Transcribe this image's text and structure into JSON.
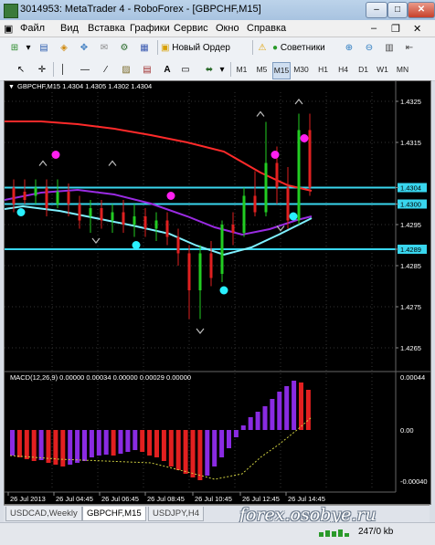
{
  "window": {
    "title": "3014953: MetaTrader 4 - RoboForex - [GBPCHF,M15]"
  },
  "menu": [
    "Файл",
    "Вид",
    "Вставка",
    "Графики",
    "Сервис",
    "Окно",
    "Справка"
  ],
  "toolbar": {
    "new_order_label": "Новый Ордер",
    "advisors_label": "Советники"
  },
  "timeframes": [
    "M1",
    "M5",
    "M15",
    "M30",
    "H1",
    "H4",
    "D1",
    "W1",
    "MN"
  ],
  "active_timeframe": "M15",
  "chart": {
    "header": "GBPCHF,M15  1.4304 1.4305 1.4302 1.4304",
    "price_ticks": [
      "1.4325",
      "1.4315",
      "1.4304",
      "1.4300",
      "1.4295",
      "1.4289",
      "1.4285",
      "1.4275",
      "1.4265"
    ],
    "price_labels_highlight": [
      "1.4304",
      "1.4300",
      "1.4289"
    ],
    "macd_header": "MACD(12,26,9) 0.00000 0.00034 0.00000 0.00029 0.00000",
    "macd_ticks": [
      "0.00044",
      "0.00",
      "-0.00040"
    ],
    "time_labels": [
      "26 Jul 2013",
      "26 Jul 04:45",
      "26 Jul 06:45",
      "26 Jul 08:45",
      "26 Jul 10:45",
      "26 Jul 12:45",
      "26 Jul 14:45"
    ]
  },
  "colors": {
    "bull": "#22cc22",
    "bear": "#e02020",
    "ma_red": "#ff2a2a",
    "ma_purple": "#9a2be2",
    "ma_cyan": "#7ff0ff",
    "level_line": "#39d6ee",
    "dot_magenta": "#ff1ff0",
    "dot_cyan": "#29f0ff"
  },
  "tabs": [
    "USDCAD,Weekly",
    "GBPCHF,M15",
    "USDJPY,H4"
  ],
  "active_tab": "GBPCHF,M15",
  "status": {
    "traffic": "247/0 kb"
  },
  "watermark": "forex.osobye.ru"
}
